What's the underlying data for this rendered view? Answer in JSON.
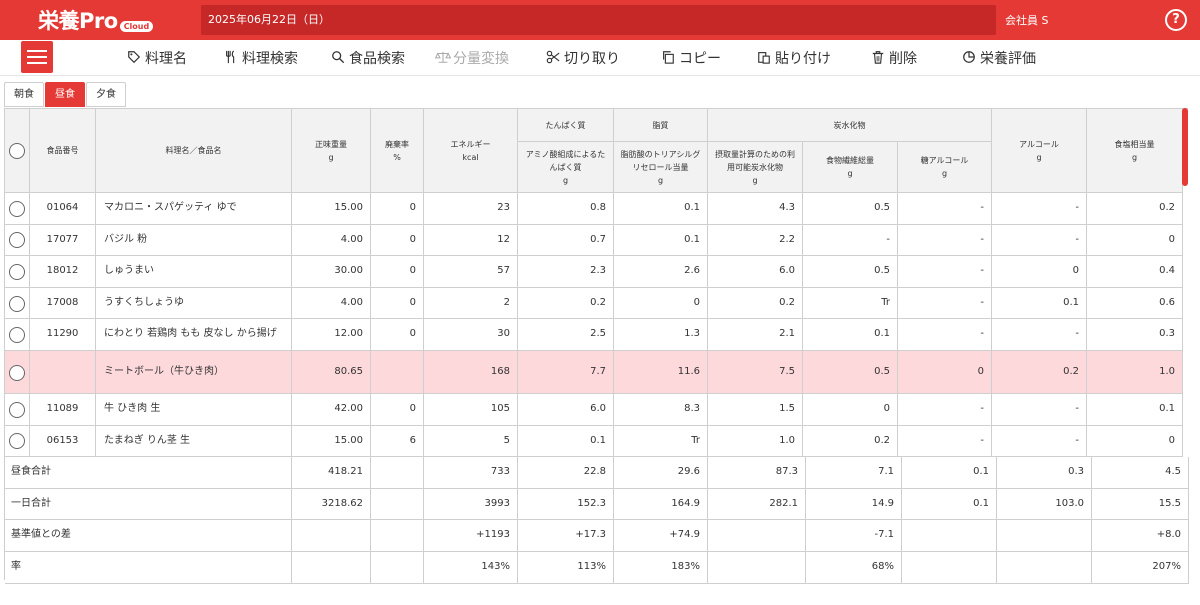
{
  "app": {
    "logo_main": "栄養Pro",
    "logo_badge": "Cloud",
    "date": "2025年06月22日（日）",
    "user": "会社員 S",
    "help": "?"
  },
  "toolbar": [
    {
      "label": "料理名",
      "icon": "tag-icon",
      "disabled": false
    },
    {
      "label": "料理検索",
      "icon": "utensils-icon",
      "disabled": false
    },
    {
      "label": "食品検索",
      "icon": "search-icon",
      "disabled": false
    },
    {
      "label": "分量変換",
      "icon": "scale-icon",
      "disabled": true
    },
    {
      "label": "切り取り",
      "icon": "scissors-icon",
      "disabled": false
    },
    {
      "label": "コピー",
      "icon": "copy-icon",
      "disabled": false
    },
    {
      "label": "貼り付け",
      "icon": "paste-icon",
      "disabled": false
    },
    {
      "label": "削除",
      "icon": "trash-icon",
      "disabled": false
    },
    {
      "label": "栄養評価",
      "icon": "pie-chart-icon",
      "disabled": false
    }
  ],
  "tabs": [
    {
      "label": "朝食",
      "active": false
    },
    {
      "label": "昼食",
      "active": true
    },
    {
      "label": "夕食",
      "active": false
    }
  ],
  "headers": {
    "code": "食品番号",
    "name": "料理名／食品名",
    "weight": [
      "正味重量",
      "g"
    ],
    "waste": [
      "廃棄率",
      "%"
    ],
    "energy": [
      "エネルギー",
      "kcal"
    ],
    "protein_group": "たんぱく質",
    "protein": [
      "アミノ酸組成によるた",
      "んぱく質",
      "g"
    ],
    "fat_group": "脂質",
    "fat": [
      "脂肪酸のトリアシルグ",
      "リセロール当量",
      "g"
    ],
    "carb_group": "炭水化物",
    "carb_avail": [
      "摂取量計算のための利",
      "用可能炭水化物",
      "g"
    ],
    "fiber": [
      "食物繊維総量",
      "g"
    ],
    "sugar_alcohol": [
      "糖アルコール",
      "g"
    ],
    "alcohol": [
      "アルコール",
      "g"
    ],
    "salt": [
      "食塩相当量",
      "g"
    ]
  },
  "rows": [
    {
      "code": "01064",
      "name": "マカロニ・スパゲッティ ゆで",
      "weight": "15.00",
      "waste": "0",
      "energy": "23",
      "protein": "0.8",
      "fat": "0.1",
      "carb": "4.3",
      "fiber": "0.5",
      "sugar_alc": "-",
      "alcohol": "-",
      "salt": "0.2",
      "highlight": false
    },
    {
      "code": "17077",
      "name": "バジル 粉",
      "weight": "4.00",
      "waste": "0",
      "energy": "12",
      "protein": "0.7",
      "fat": "0.1",
      "carb": "2.2",
      "fiber": "-",
      "sugar_alc": "-",
      "alcohol": "-",
      "salt": "0",
      "highlight": false
    },
    {
      "code": "18012",
      "name": "しゅうまい",
      "weight": "30.00",
      "waste": "0",
      "energy": "57",
      "protein": "2.3",
      "fat": "2.6",
      "carb": "6.0",
      "fiber": "0.5",
      "sugar_alc": "-",
      "alcohol": "0",
      "salt": "0.4",
      "highlight": false
    },
    {
      "code": "17008",
      "name": "うすくちしょうゆ",
      "weight": "4.00",
      "waste": "0",
      "energy": "2",
      "protein": "0.2",
      "fat": "0",
      "carb": "0.2",
      "fiber": "Tr",
      "sugar_alc": "-",
      "alcohol": "0.1",
      "salt": "0.6",
      "highlight": false
    },
    {
      "code": "11290",
      "name": "にわとり 若鶏肉 もも 皮なし から揚げ",
      "weight": "12.00",
      "waste": "0",
      "energy": "30",
      "protein": "2.5",
      "fat": "1.3",
      "carb": "2.1",
      "fiber": "0.1",
      "sugar_alc": "-",
      "alcohol": "-",
      "salt": "0.3",
      "highlight": false
    },
    {
      "code": "",
      "name": "ミートボール（牛ひき肉）",
      "weight": "80.65",
      "waste": "",
      "energy": "168",
      "protein": "7.7",
      "fat": "11.6",
      "carb": "7.5",
      "fiber": "0.5",
      "sugar_alc": "0",
      "alcohol": "0.2",
      "salt": "1.0",
      "highlight": true
    },
    {
      "code": "11089",
      "name": "牛 ひき肉 生",
      "weight": "42.00",
      "waste": "0",
      "energy": "105",
      "protein": "6.0",
      "fat": "8.3",
      "carb": "1.5",
      "fiber": "0",
      "sugar_alc": "-",
      "alcohol": "-",
      "salt": "0.1",
      "highlight": false
    },
    {
      "code": "06153",
      "name": "たまねぎ りん茎 生",
      "weight": "15.00",
      "waste": "6",
      "energy": "5",
      "protein": "0.1",
      "fat": "Tr",
      "carb": "1.0",
      "fiber": "0.2",
      "sugar_alc": "-",
      "alcohol": "-",
      "salt": "0",
      "highlight": false
    }
  ],
  "summary": [
    {
      "label": "昼食合計",
      "weight": "418.21",
      "energy": "733",
      "protein": "22.8",
      "fat": "29.6",
      "carb": "87.3",
      "fiber": "7.1",
      "sugar_alc": "0.1",
      "alcohol": "0.3",
      "salt": "4.5"
    },
    {
      "label": "一日合計",
      "weight": "3218.62",
      "energy": "3993",
      "protein": "152.3",
      "fat": "164.9",
      "carb": "282.1",
      "fiber": "14.9",
      "sugar_alc": "0.1",
      "alcohol": "103.0",
      "salt": "15.5"
    },
    {
      "label": "基準値との差",
      "weight": "",
      "energy": "+1193",
      "protein": "+17.3",
      "fat": "+74.9",
      "carb": "",
      "fiber": "-7.1",
      "sugar_alc": "",
      "alcohol": "",
      "salt": "+8.0"
    },
    {
      "label": "率",
      "weight": "",
      "energy": "143%",
      "protein": "113%",
      "fat": "183%",
      "carb": "",
      "fiber": "68%",
      "sugar_alc": "",
      "alcohol": "",
      "salt": "207%"
    }
  ],
  "colors": {
    "accent": "#e53935",
    "accent_dark": "#c62828",
    "highlight_row": "#fdd9dc",
    "header_bg": "#f2f2f2"
  }
}
